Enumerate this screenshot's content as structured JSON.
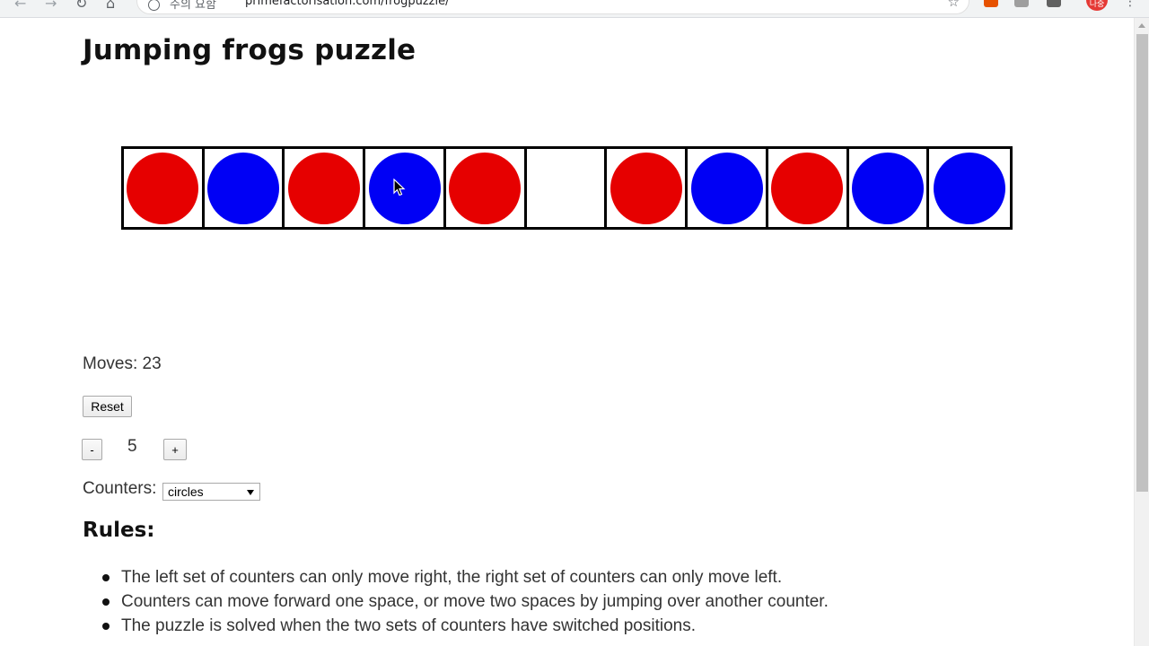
{
  "browser": {
    "url_security": "주의 요함",
    "url": "primefactorisation.com/frogpuzzle/",
    "profile_initials": "나중"
  },
  "page": {
    "title": "Jumping frogs puzzle"
  },
  "board": {
    "cells": [
      "red",
      "blue",
      "red",
      "blue",
      "red",
      "empty",
      "red",
      "blue",
      "red",
      "blue",
      "blue"
    ],
    "colors": {
      "red": "#e60000",
      "blue": "#0000f5"
    }
  },
  "moves": {
    "label": "Moves: ",
    "value": "23"
  },
  "controls": {
    "reset_label": "Reset",
    "minus_label": "-",
    "plus_label": "+",
    "count_value": "5",
    "counters_label": "Counters:",
    "counters_selected": "circles"
  },
  "rules": {
    "title": "Rules:",
    "items": [
      "The left set of counters can only move right, the right set of counters can only move left.",
      "Counters can move forward one space, or move two spaces by jumping over another counter.",
      "The puzzle is solved when the two sets of counters have switched positions."
    ]
  }
}
